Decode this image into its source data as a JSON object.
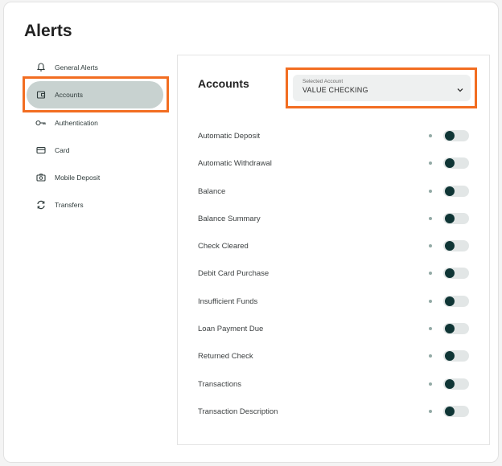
{
  "page": {
    "title": "Alerts"
  },
  "sidebar": {
    "items": [
      {
        "label": "General Alerts",
        "icon": "bell-icon"
      },
      {
        "label": "Accounts",
        "icon": "wallet-icon",
        "active": true
      },
      {
        "label": "Authentication",
        "icon": "key-icon"
      },
      {
        "label": "Card",
        "icon": "credit-card-icon"
      },
      {
        "label": "Mobile Deposit",
        "icon": "camera-icon"
      },
      {
        "label": "Transfers",
        "icon": "transfer-arrows-icon"
      }
    ]
  },
  "panel": {
    "title": "Accounts",
    "account_select": {
      "label": "Selected Account",
      "value": "VALUE CHECKING"
    },
    "alerts": [
      {
        "label": "Automatic Deposit",
        "enabled": false
      },
      {
        "label": "Automatic Withdrawal",
        "enabled": false
      },
      {
        "label": "Balance",
        "enabled": false
      },
      {
        "label": "Balance Summary",
        "enabled": false
      },
      {
        "label": "Check Cleared",
        "enabled": false
      },
      {
        "label": "Debit Card Purchase",
        "enabled": false
      },
      {
        "label": "Insufficient Funds",
        "enabled": false
      },
      {
        "label": "Loan Payment Due",
        "enabled": false
      },
      {
        "label": "Returned Check",
        "enabled": false
      },
      {
        "label": "Transactions",
        "enabled": false
      },
      {
        "label": "Transaction Description",
        "enabled": false
      }
    ]
  },
  "colors": {
    "highlight": "#f26d21",
    "active_nav": "#c8d2d0",
    "toggle_knob": "#0f3535",
    "toggle_track": "#e2e6e6"
  }
}
